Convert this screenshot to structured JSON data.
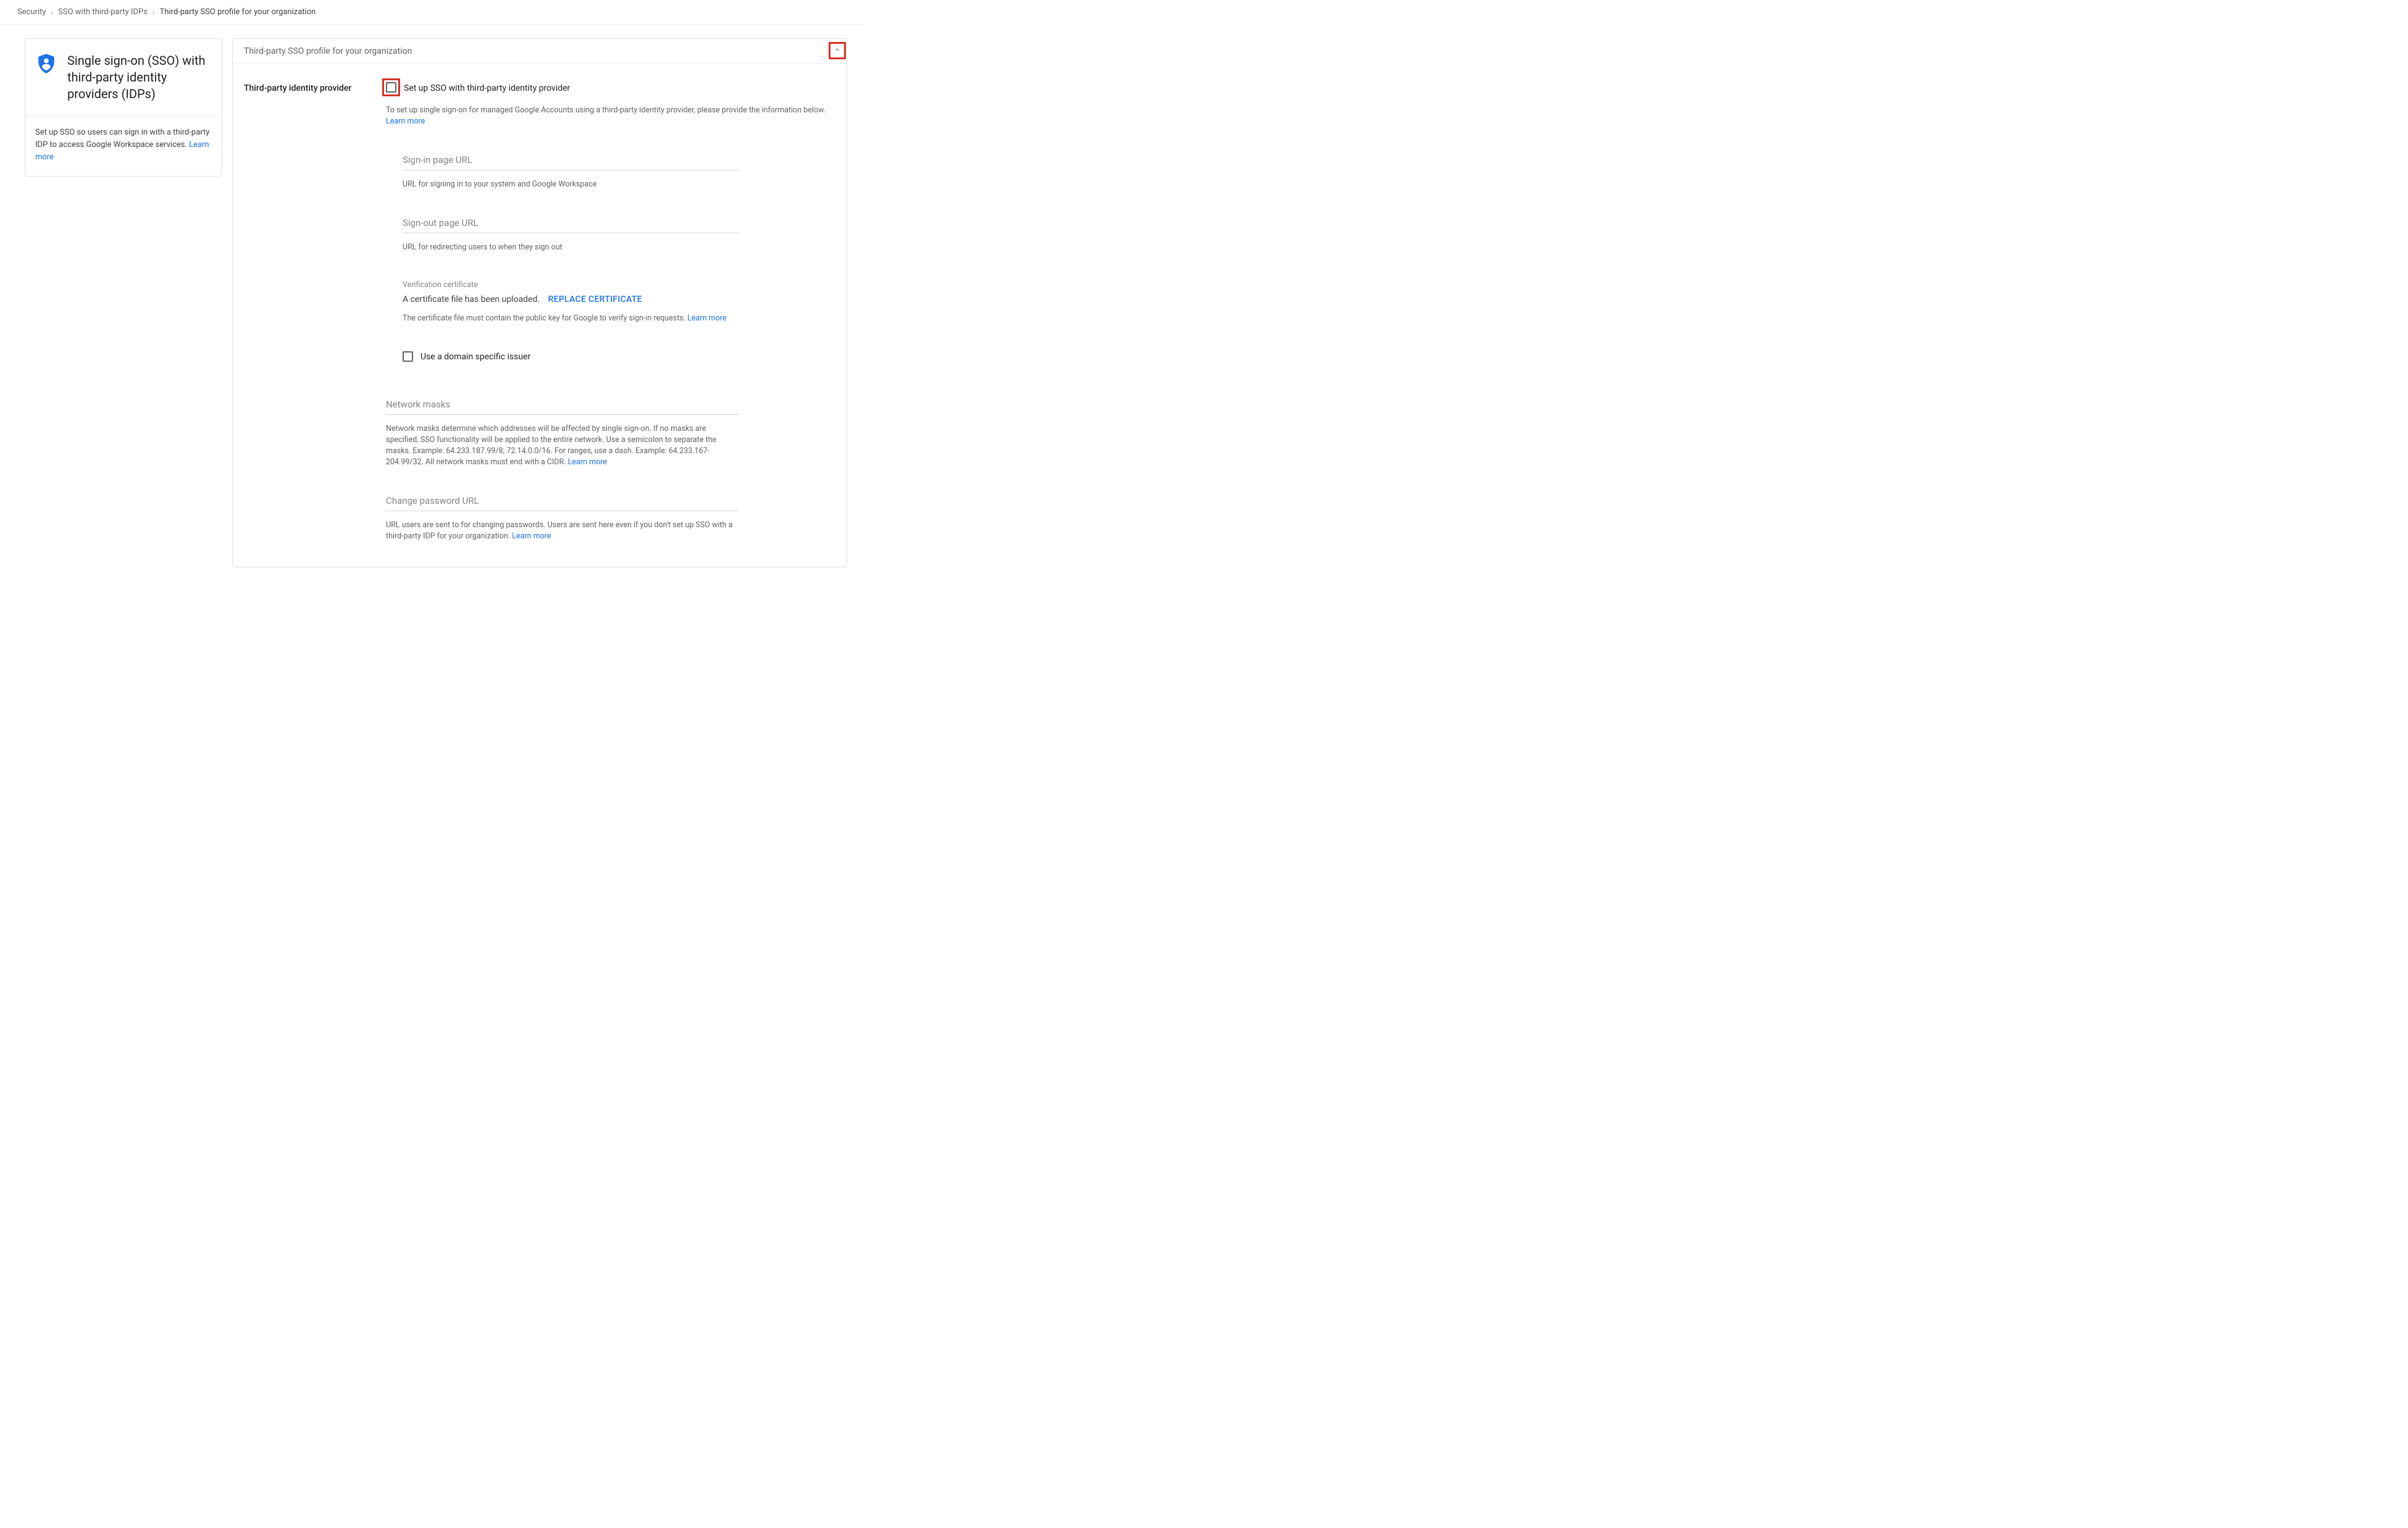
{
  "breadcrumbs": {
    "a": "Security",
    "b": "SSO with third-party IDPs",
    "c": "Third-party SSO profile for your organization"
  },
  "side": {
    "title": "Single sign-on (SSO) with third-party identity providers (IDPs)",
    "desc": "Set up SSO so users can sign in with a third-party IDP to access Google Workspace services. ",
    "learn": "Learn more"
  },
  "main": {
    "header": "Third-party SSO profile for your organization",
    "left_label": "Third-party identity provider",
    "setup_label": "Set up SSO with third-party identity provider",
    "setup_help": "To set up single sign-on for managed Google Accounts using a third-party identity provider, please provide the information below. ",
    "learn": "Learn more",
    "signin": {
      "ph": "Sign-in page URL",
      "cap": "URL for signing in to your system and Google Workspace"
    },
    "signout": {
      "ph": "Sign-out page URL",
      "cap": "URL for redirecting users to when they sign out"
    },
    "cert": {
      "label": "Verification certificate",
      "uploaded": "A certificate file has been uploaded.",
      "replace": "REPLACE CERTIFICATE",
      "cap": "The certificate file must contain the public key for Google to verify sign-in requests. ",
      "learn": "Learn more"
    },
    "domain_issuer": "Use a domain specific issuer",
    "masks": {
      "ph": "Network masks",
      "cap": "Network masks determine which addresses will be affected by single sign-on. If no masks are specified, SSO functionality will be applied to the entire network. Use a semicolon to separate the masks. Example: 64.233.187.99/8; 72.14.0.0/16. For ranges, use a dash. Example: 64.233.167-204.99/32. All network masks must end with a CIDR. ",
      "learn": "Learn more"
    },
    "changepw": {
      "ph": "Change password URL",
      "cap": "URL users are sent to for changing passwords. Users are sent here even if you don't set up SSO with a third-party IDP for your organization. ",
      "learn": "Learn more"
    }
  }
}
